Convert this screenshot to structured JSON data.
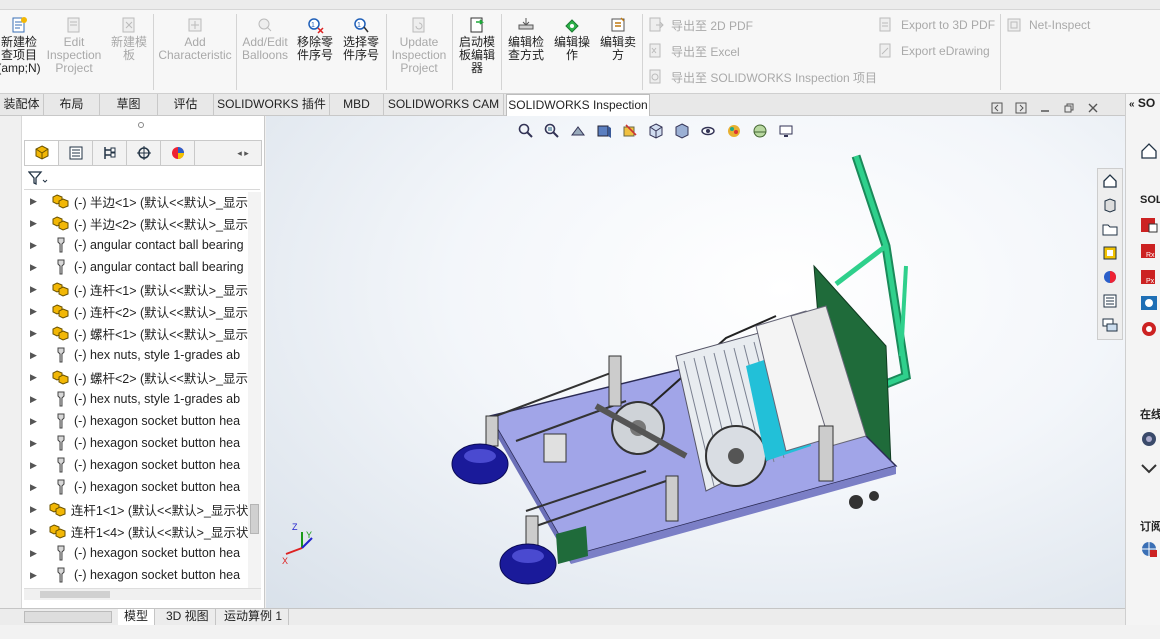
{
  "ribbon": {
    "new_project": "新建检\n查项目\n(amp;N)",
    "edit_project": "Edit\nInspection\nProject",
    "new_template": "新建模\n板",
    "add_characteristic": "Add\nCharacteristic",
    "add_edit_balloons": "Add/Edit\nBalloons",
    "remove_part_number": "移除零\n件序号",
    "select_part_number": "选择零\n件序号",
    "update_project": "Update\nInspection\nProject",
    "launch_template_editor": "启动模\n板编辑\n器",
    "edit_inspection_method": "编辑检\n查方式",
    "edit_operation": "编辑操\n作",
    "edit_vendor": "编辑卖\n方",
    "export_2d_pdf": "导出至 2D PDF",
    "export_excel": "导出至 Excel",
    "export_inspection_project": "导出至 SOLIDWORKS Inspection 项目",
    "export_3d_pdf": "Export to 3D PDF",
    "export_edrawing": "Export eDrawing",
    "net_inspect": "Net-Inspect"
  },
  "tabs": [
    {
      "label": "装配体"
    },
    {
      "label": "布局"
    },
    {
      "label": "草图"
    },
    {
      "label": "评估"
    },
    {
      "label": "SOLIDWORKS 插件"
    },
    {
      "label": "MBD"
    },
    {
      "label": "SOLIDWORKS CAM"
    },
    {
      "label": "SOLIDWORKS Inspection"
    }
  ],
  "tree": [
    {
      "kind": "asm",
      "label": "(-) 半边<1> (默认<<默认>_显示"
    },
    {
      "kind": "asm",
      "label": "(-) 半边<2> (默认<<默认>_显示"
    },
    {
      "kind": "part",
      "label": "(-) angular contact ball bearing"
    },
    {
      "kind": "part",
      "label": "(-) angular contact ball bearing"
    },
    {
      "kind": "asm",
      "label": "(-) 连杆<1> (默认<<默认>_显示"
    },
    {
      "kind": "asm",
      "label": "(-) 连杆<2> (默认<<默认>_显示"
    },
    {
      "kind": "asm",
      "label": "(-) 螺杆<1> (默认<<默认>_显示"
    },
    {
      "kind": "part",
      "label": "(-) hex nuts, style 1-grades ab"
    },
    {
      "kind": "asm",
      "label": "(-) 螺杆<2> (默认<<默认>_显示"
    },
    {
      "kind": "part",
      "label": "(-) hex nuts, style 1-grades ab"
    },
    {
      "kind": "part",
      "label": "(-) hexagon socket button hea"
    },
    {
      "kind": "part",
      "label": "(-) hexagon socket button hea"
    },
    {
      "kind": "part",
      "label": "(-) hexagon socket button hea"
    },
    {
      "kind": "part",
      "label": "(-) hexagon socket button hea"
    },
    {
      "kind": "asm",
      "label": "连杆1<1> (默认<<默认>_显示状"
    },
    {
      "kind": "asm",
      "label": "连杆1<4> (默认<<默认>_显示状"
    },
    {
      "kind": "part",
      "label": "(-) hexagon socket button hea"
    },
    {
      "kind": "part",
      "label": "(-) hexagon socket button hea"
    }
  ],
  "bottom_tabs": [
    {
      "label": "模型"
    },
    {
      "label": "3D 视图"
    },
    {
      "label": "运动算例 1"
    }
  ],
  "right_pane": {
    "header": "SO",
    "section1": "SOL",
    "section2": "在线",
    "section3": "订阅"
  },
  "colors": {
    "accent_blue": "#1f5fb8",
    "plate": "#9fa4e6",
    "handle_green": "#1fb37a",
    "wheel": "#1a1a9a",
    "cyan": "#22c0d8"
  }
}
